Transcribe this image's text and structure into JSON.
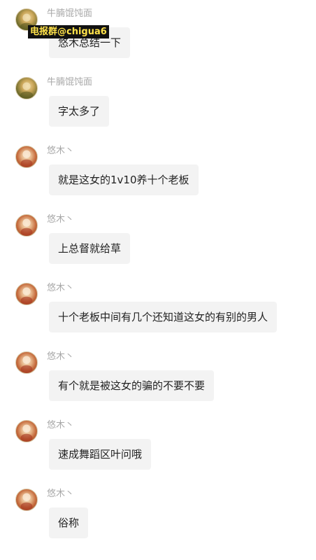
{
  "watermark": "电报群@chigua6",
  "messages": [
    {
      "sender": "牛腩馄饨面",
      "text": "悠木总结一下",
      "avatar": "avatar-niunan"
    },
    {
      "sender": "牛腩馄饨面",
      "text": "字太多了",
      "avatar": "avatar-niunan"
    },
    {
      "sender": "悠木丶",
      "text": "就是这女的1v10养十个老板",
      "avatar": "avatar-youmu"
    },
    {
      "sender": "悠木丶",
      "text": "上总督就给草",
      "avatar": "avatar-youmu"
    },
    {
      "sender": "悠木丶",
      "text": "十个老板中间有几个还知道这女的有别的男人",
      "avatar": "avatar-youmu"
    },
    {
      "sender": "悠木丶",
      "text": "有个就是被这女的骗的不要不要",
      "avatar": "avatar-youmu"
    },
    {
      "sender": "悠木丶",
      "text": "速成舞蹈区叶问哦",
      "avatar": "avatar-youmu"
    },
    {
      "sender": "悠木丶",
      "text": "俗称",
      "avatar": "avatar-youmu"
    }
  ]
}
